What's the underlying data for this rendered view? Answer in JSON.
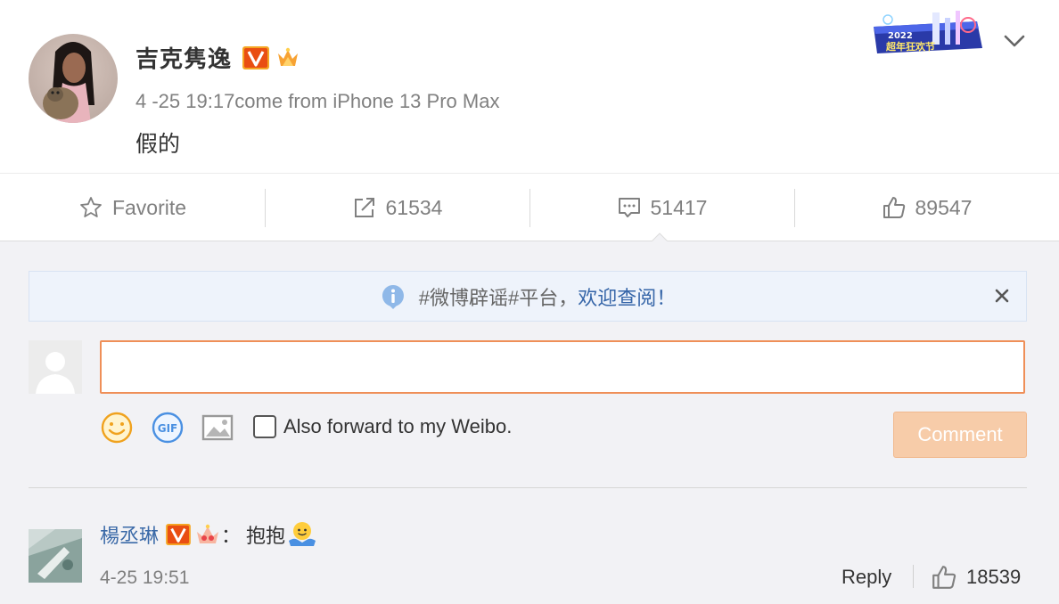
{
  "post": {
    "author": "吉克隽逸",
    "meta": "4 -25 19:17come from iPhone 13 Pro Max",
    "text": "假的",
    "festival_badge_text": "2022 超年狂欢节"
  },
  "actions": [
    {
      "label": "Favorite",
      "icon": "star-icon"
    },
    {
      "label": "61534",
      "icon": "share-icon"
    },
    {
      "label": "51417",
      "icon": "comment-icon"
    },
    {
      "label": "89547",
      "icon": "thumbs-up-icon"
    }
  ],
  "notice": {
    "text": "#微博辟谣#平台，",
    "link": "欢迎查阅！"
  },
  "composer": {
    "input_value": "",
    "forward_label": "Also forward to my Weibo.",
    "submit_label": "Comment"
  },
  "comments": [
    {
      "user": "楊丞琳",
      "separator": "：",
      "text": "抱抱",
      "time": "4-25 19:51",
      "reply_label": "Reply",
      "likes": "18539"
    }
  ],
  "colors": {
    "accent_orange": "#ef8f58",
    "link_blue": "#3b6aa8",
    "muted_gray": "#808080",
    "comment_bg": "#f2f2f5"
  }
}
